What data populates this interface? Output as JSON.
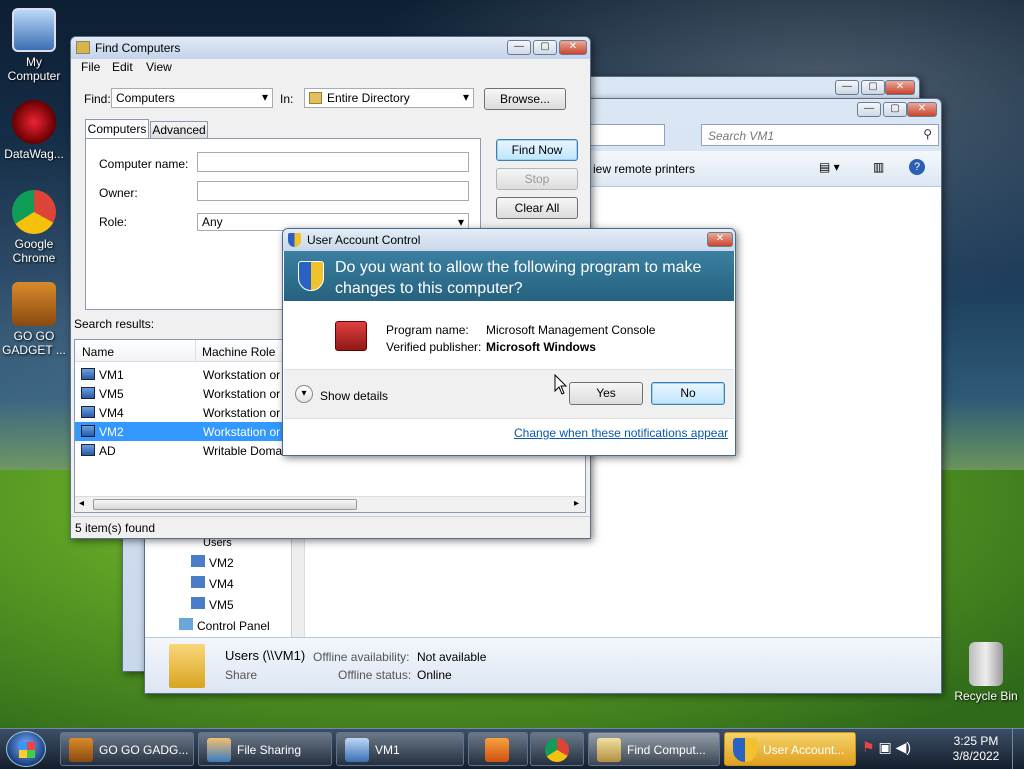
{
  "desktop": {
    "icons": [
      {
        "label": "My Computer"
      },
      {
        "label": "DataWag..."
      },
      {
        "label": "Google Chrome"
      },
      {
        "label": "GO GO GADGET ..."
      },
      {
        "label": "Recycle Bin"
      }
    ]
  },
  "explorer_back": {
    "search_placeholder": "Search VM1",
    "toolbar_link": "iew remote printers",
    "tree": [
      "Users",
      "VM2",
      "VM4",
      "VM5",
      "Control Panel"
    ],
    "details": {
      "name": "Users (\\\\VM1)",
      "type": "Share",
      "offline_availability_label": "Offline availability:",
      "offline_availability_value": "Not available",
      "offline_status_label": "Offline status:",
      "offline_status_value": "Online"
    }
  },
  "find_computers": {
    "title": "Find Computers",
    "menu": [
      "File",
      "Edit",
      "View"
    ],
    "find_label": "Find:",
    "find_value": "Computers",
    "in_label": "In:",
    "in_value": "Entire Directory",
    "browse": "Browse...",
    "tabs": [
      "Computers",
      "Advanced"
    ],
    "computer_name_label": "Computer name:",
    "owner_label": "Owner:",
    "role_label": "Role:",
    "role_value": "Any",
    "find_now": "Find Now",
    "stop": "Stop",
    "clear_all": "Clear All",
    "search_results_label": "Search results:",
    "columns": [
      "Name",
      "Machine Role"
    ],
    "rows": [
      {
        "name": "VM1",
        "role": "Workstation or"
      },
      {
        "name": "VM5",
        "role": "Workstation or"
      },
      {
        "name": "VM4",
        "role": "Workstation or"
      },
      {
        "name": "VM2",
        "role": "Workstation or"
      },
      {
        "name": "AD",
        "role": "Writable Doma"
      }
    ],
    "selected_row": 3,
    "status": "5 item(s) found"
  },
  "uac": {
    "title": "User Account Control",
    "question": "Do you want to allow the following program to make changes to this computer?",
    "program_name_label": "Program name:",
    "program_name_value": "Microsoft Management Console",
    "publisher_label": "Verified publisher:",
    "publisher_value": "Microsoft Windows",
    "show_details": "Show details",
    "yes": "Yes",
    "no": "No",
    "change_link": "Change when these notifications appear"
  },
  "taskbar": {
    "items": [
      {
        "label": "GO GO GADG..."
      },
      {
        "label": "File Sharing"
      },
      {
        "label": "VM1"
      },
      {
        "label": ""
      },
      {
        "label": ""
      },
      {
        "label": "Find Comput..."
      },
      {
        "label": "User Account..."
      }
    ],
    "time": "3:25 PM",
    "date": "3/8/2022"
  },
  "colors": {
    "uac_banner": "#2f6f8f",
    "selection": "#3399ff",
    "link": "#0a5aa8"
  }
}
